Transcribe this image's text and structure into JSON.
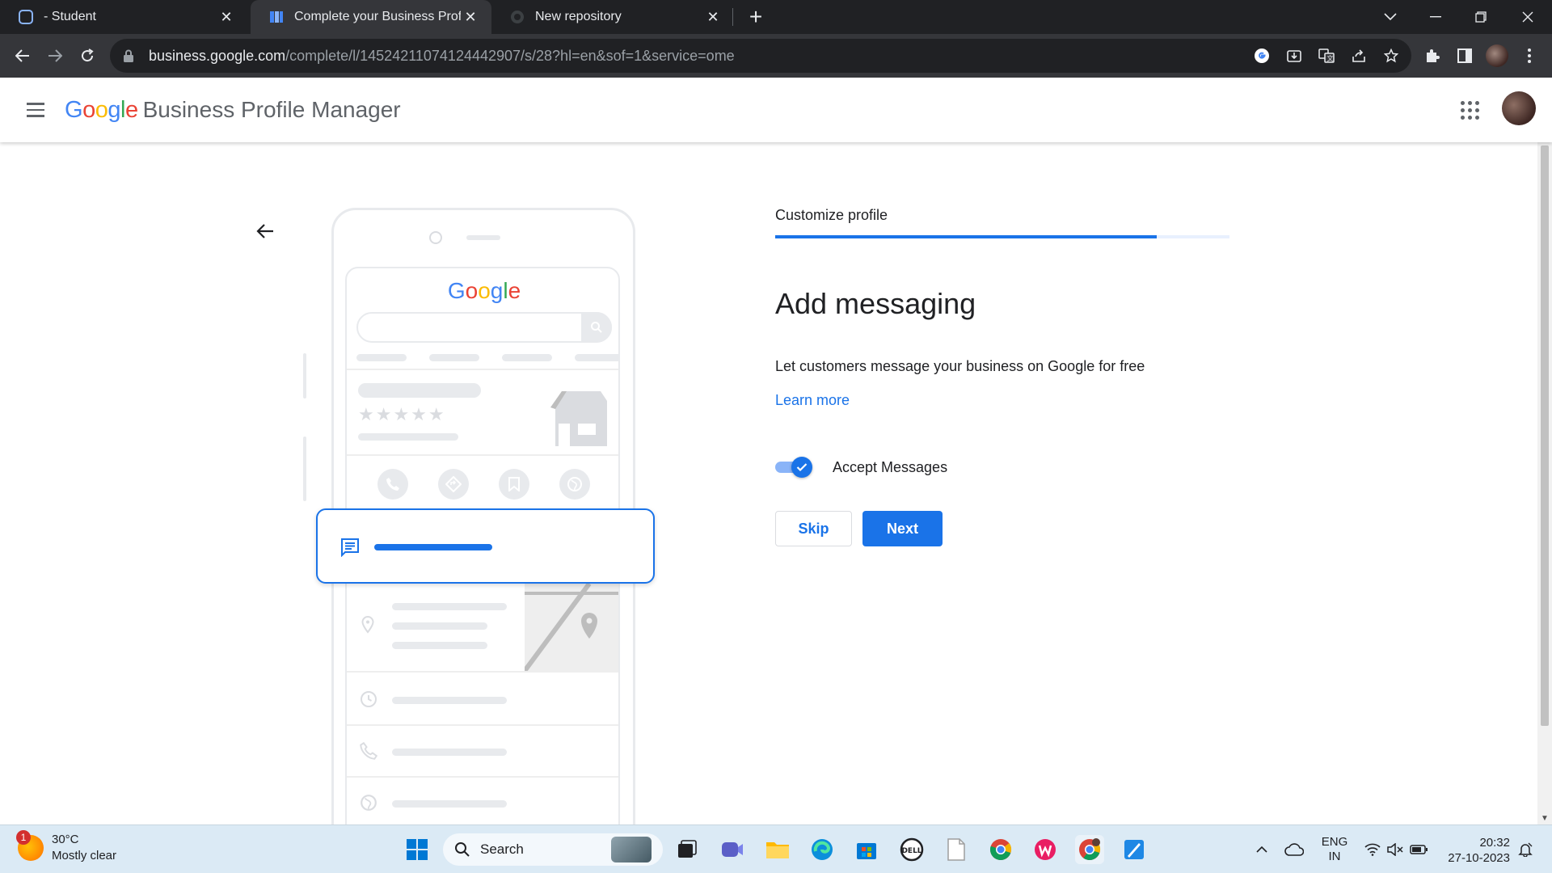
{
  "browser": {
    "tabs": [
      {
        "title": "- Student"
      },
      {
        "title": "Complete your Business Profile"
      },
      {
        "title": "New repository"
      }
    ],
    "url_host": "business.google.com",
    "url_path": "/complete/l/14524211074124442907/s/28?hl=en&sof=1&service=ome"
  },
  "header": {
    "logo_letters": [
      "G",
      "o",
      "o",
      "g",
      "l",
      "e"
    ],
    "logo_colors": [
      "#4285f4",
      "#ea4335",
      "#fbbc05",
      "#4285f4",
      "#34a853",
      "#ea4335"
    ],
    "product": "Business Profile Manager"
  },
  "main": {
    "step_label": "Customize profile",
    "progress_fraction": 0.84,
    "heading": "Add messaging",
    "description": "Let customers message your business on Google for free",
    "learn_more": "Learn more",
    "toggle_label": "Accept Messages",
    "toggle_on": true,
    "skip_label": "Skip",
    "next_label": "Next"
  },
  "colors": {
    "accent": "#1a73e8",
    "accent_light": "#8ab4f8"
  },
  "taskbar": {
    "weather_badge": "1",
    "temperature": "30°C",
    "weather_desc": "Mostly clear",
    "search_placeholder": "Search",
    "lang_line1": "ENG",
    "lang_line2": "IN",
    "time": "20:32",
    "date": "27-10-2023"
  }
}
